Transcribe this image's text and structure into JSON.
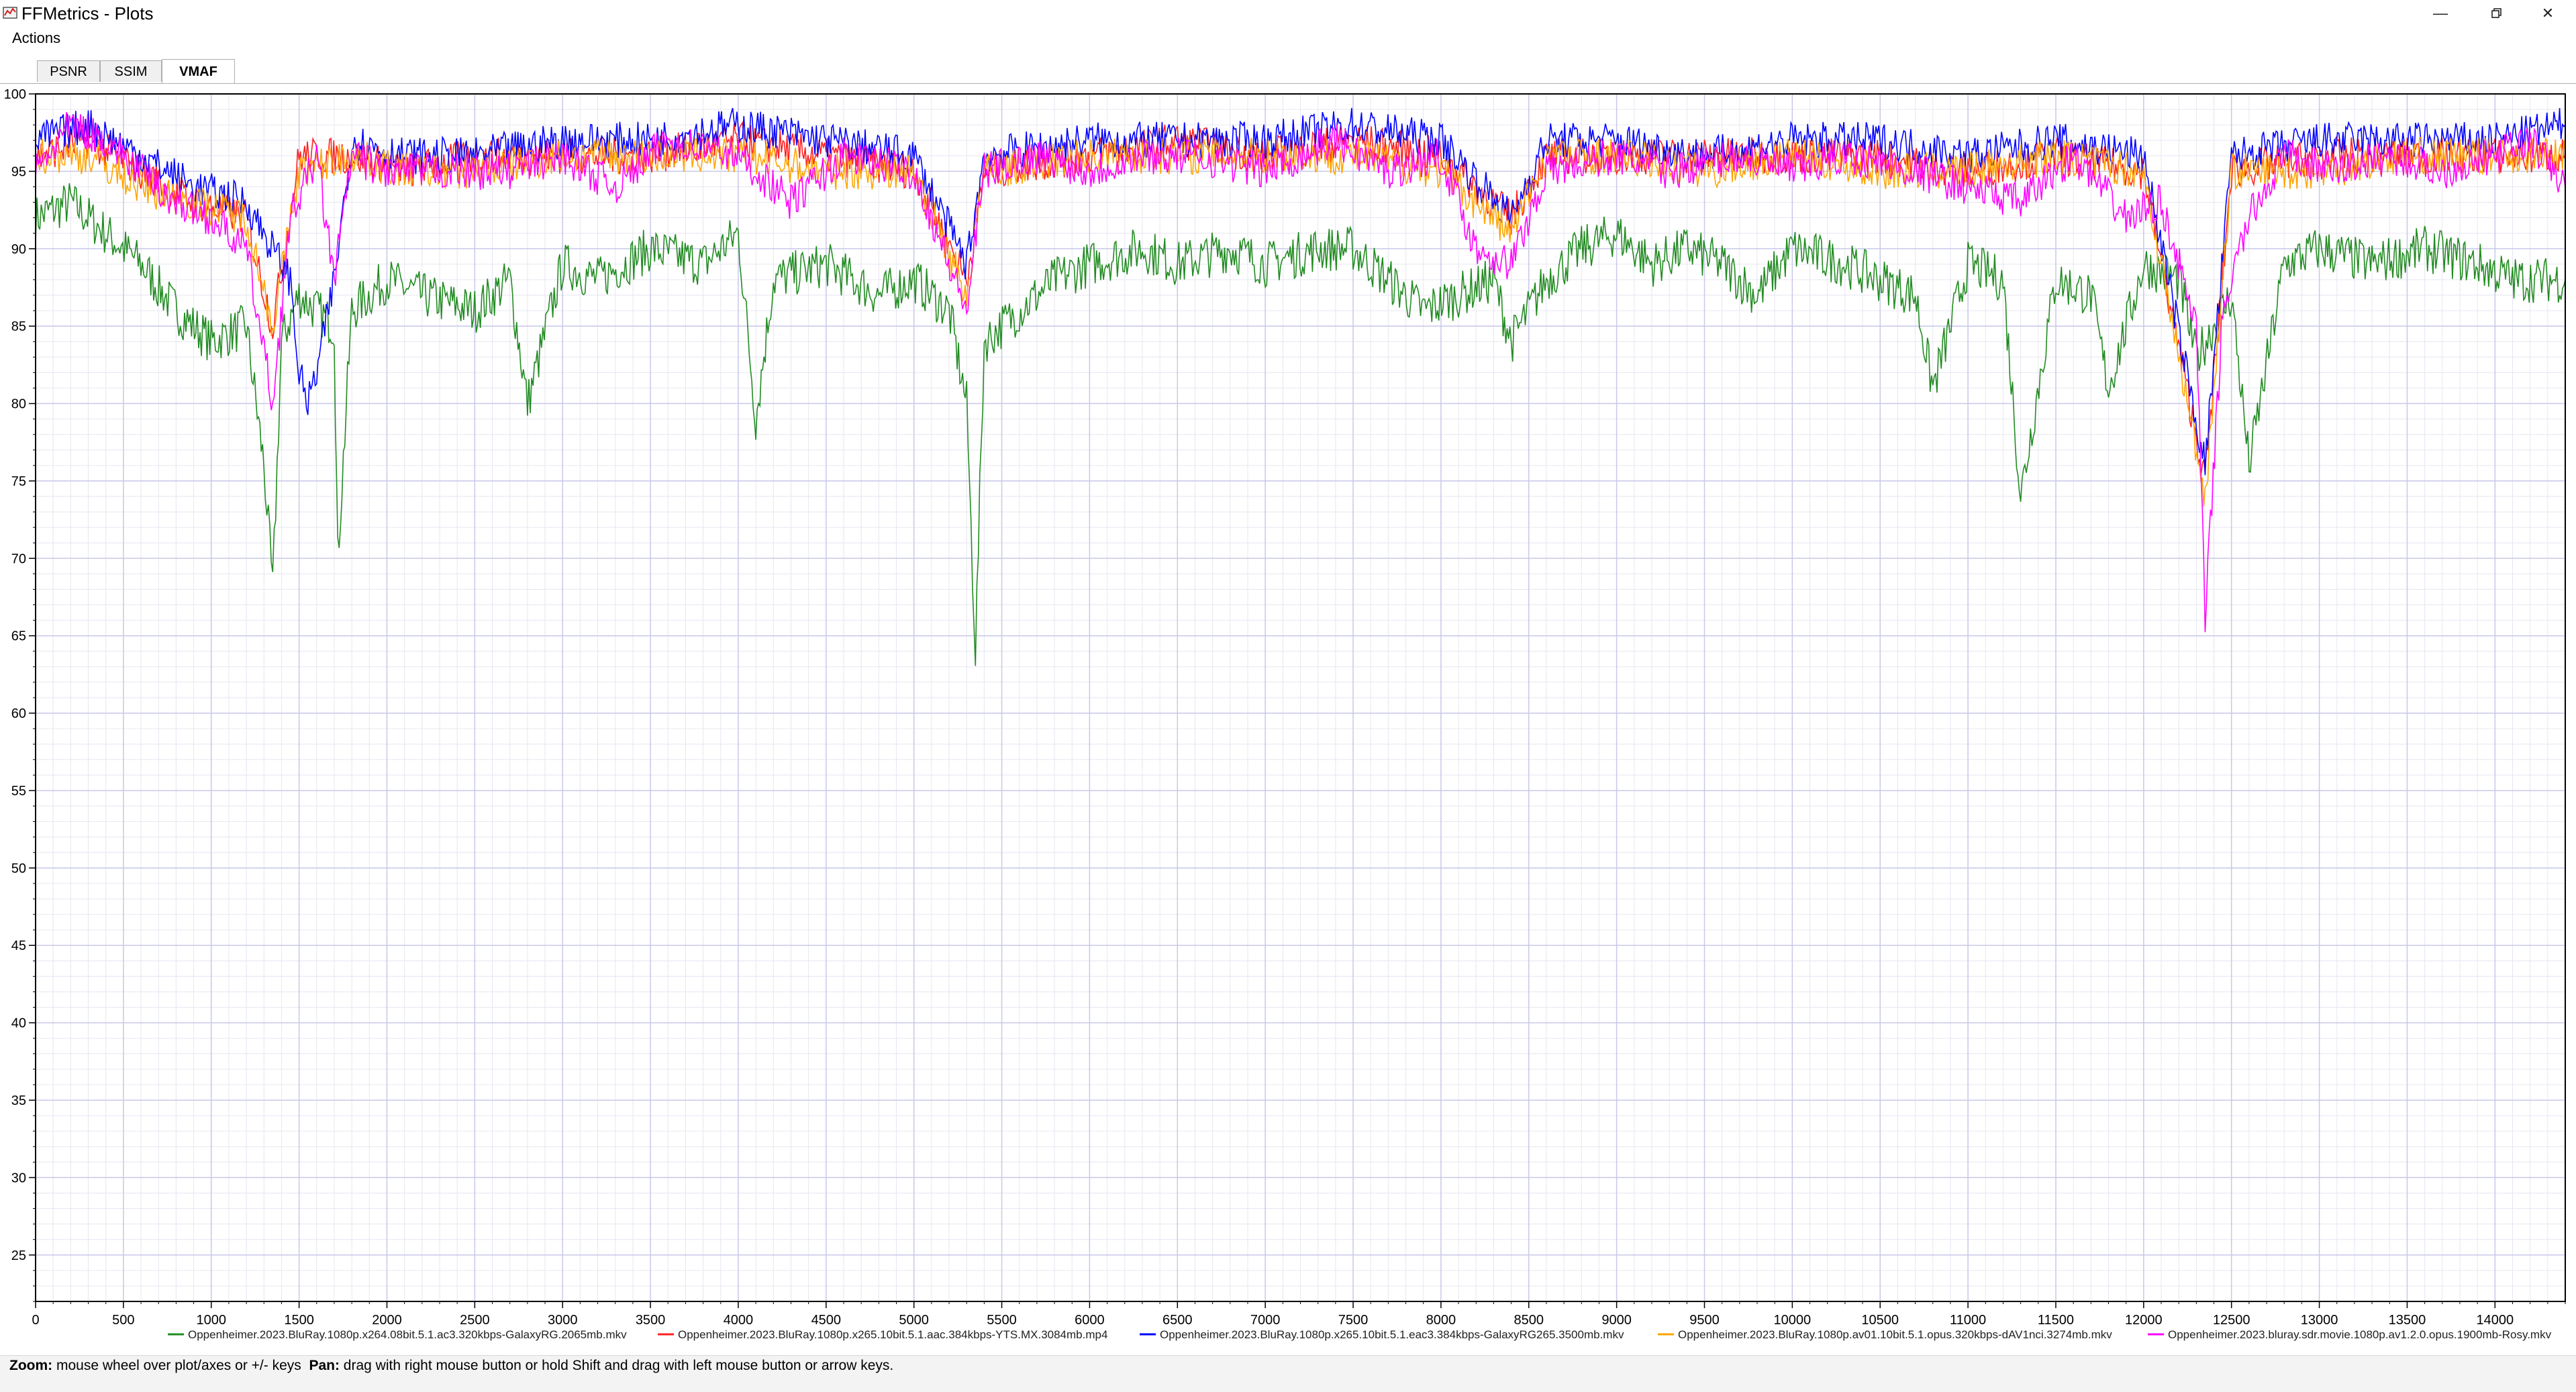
{
  "window": {
    "title": "FFMetrics - Plots"
  },
  "menu": {
    "actions_label": "Actions"
  },
  "tabs": [
    {
      "label": "PSNR",
      "active": false
    },
    {
      "label": "SSIM",
      "active": false
    },
    {
      "label": "VMAF",
      "active": true
    }
  ],
  "status": {
    "zoom_label": "Zoom:",
    "zoom_text": "mouse wheel over plot/axes or +/- keys",
    "pan_label": "Pan:",
    "pan_text": "drag with right mouse button or hold Shift and drag with left mouse button or arrow keys."
  },
  "chart_data": {
    "type": "line",
    "xlim": [
      0,
      14400
    ],
    "ylim": [
      22,
      100
    ],
    "x_ticks": [
      0,
      500,
      1000,
      1500,
      2000,
      2500,
      3000,
      3500,
      4000,
      4500,
      5000,
      5500,
      6000,
      6500,
      7000,
      7500,
      8000,
      8500,
      9000,
      9500,
      10000,
      10500,
      11000,
      11500,
      12000,
      12500,
      13000,
      13500,
      14000
    ],
    "y_ticks": [
      25,
      30,
      35,
      40,
      45,
      50,
      55,
      60,
      65,
      70,
      75,
      80,
      85,
      90,
      95,
      100
    ],
    "grid": true,
    "legend_placement": "bottom",
    "series": [
      {
        "name": "Oppenheimer.2023.BluRay.1080p.x264.08bit.5.1.ac3.320kbps-GalaxyRG.2065mb.mkv",
        "color": "#228b22",
        "points": [
          [
            0,
            92
          ],
          [
            200,
            93
          ],
          [
            400,
            91
          ],
          [
            600,
            89
          ],
          [
            800,
            86
          ],
          [
            1000,
            84
          ],
          [
            1200,
            85
          ],
          [
            1300,
            76
          ],
          [
            1350,
            68
          ],
          [
            1400,
            84
          ],
          [
            1500,
            87
          ],
          [
            1600,
            86
          ],
          [
            1700,
            85
          ],
          [
            1720,
            70
          ],
          [
            1800,
            86
          ],
          [
            2000,
            88
          ],
          [
            2200,
            87
          ],
          [
            2500,
            86
          ],
          [
            2700,
            88
          ],
          [
            2800,
            80
          ],
          [
            3000,
            89
          ],
          [
            3200,
            88
          ],
          [
            3500,
            90
          ],
          [
            3800,
            89
          ],
          [
            4000,
            91
          ],
          [
            4100,
            79
          ],
          [
            4200,
            88
          ],
          [
            4500,
            89
          ],
          [
            4800,
            87
          ],
          [
            5000,
            88
          ],
          [
            5200,
            86
          ],
          [
            5300,
            80
          ],
          [
            5350,
            64
          ],
          [
            5400,
            84
          ],
          [
            5600,
            86
          ],
          [
            5800,
            88
          ],
          [
            6000,
            89
          ],
          [
            6300,
            90
          ],
          [
            6500,
            89
          ],
          [
            6800,
            90
          ],
          [
            7000,
            89
          ],
          [
            7300,
            90
          ],
          [
            7500,
            90
          ],
          [
            7700,
            88
          ],
          [
            7900,
            86
          ],
          [
            8100,
            87
          ],
          [
            8300,
            88
          ],
          [
            8400,
            84
          ],
          [
            8600,
            88
          ],
          [
            8800,
            90
          ],
          [
            9000,
            91
          ],
          [
            9200,
            89
          ],
          [
            9400,
            90
          ],
          [
            9600,
            89
          ],
          [
            9800,
            87
          ],
          [
            10000,
            90
          ],
          [
            10300,
            89
          ],
          [
            10500,
            88
          ],
          [
            10700,
            87
          ],
          [
            10800,
            81
          ],
          [
            11000,
            89
          ],
          [
            11200,
            88
          ],
          [
            11300,
            74
          ],
          [
            11500,
            88
          ],
          [
            11700,
            87
          ],
          [
            11800,
            81
          ],
          [
            12000,
            89
          ],
          [
            12200,
            88
          ],
          [
            12300,
            83
          ],
          [
            12500,
            87
          ],
          [
            12600,
            76
          ],
          [
            12800,
            89
          ],
          [
            13000,
            90
          ],
          [
            13300,
            89
          ],
          [
            13600,
            90
          ],
          [
            13900,
            89
          ],
          [
            14100,
            88
          ],
          [
            14400,
            88
          ]
        ]
      },
      {
        "name": "Oppenheimer.2023.BluRay.1080p.x265.10bit.5.1.aac.384kbps-YTS.MX.3084mb.mp4",
        "color": "#ff2020",
        "points": [
          [
            0,
            96
          ],
          [
            300,
            97
          ],
          [
            600,
            95
          ],
          [
            900,
            93
          ],
          [
            1200,
            92
          ],
          [
            1350,
            85
          ],
          [
            1500,
            96
          ],
          [
            1800,
            96
          ],
          [
            2100,
            95
          ],
          [
            2500,
            96
          ],
          [
            3000,
            96
          ],
          [
            3500,
            96
          ],
          [
            4000,
            97
          ],
          [
            4500,
            96
          ],
          [
            5000,
            95
          ],
          [
            5300,
            88
          ],
          [
            5400,
            95
          ],
          [
            6000,
            96
          ],
          [
            6500,
            97
          ],
          [
            7000,
            96
          ],
          [
            7500,
            97
          ],
          [
            8000,
            96
          ],
          [
            8400,
            92
          ],
          [
            8600,
            96
          ],
          [
            9000,
            96
          ],
          [
            9500,
            96
          ],
          [
            10000,
            96
          ],
          [
            10500,
            96
          ],
          [
            11000,
            95
          ],
          [
            11500,
            96
          ],
          [
            12000,
            95
          ],
          [
            12350,
            75
          ],
          [
            12500,
            95
          ],
          [
            13000,
            96
          ],
          [
            13500,
            96
          ],
          [
            14000,
            96
          ],
          [
            14400,
            96
          ]
        ]
      },
      {
        "name": "Oppenheimer.2023.BluRay.1080p.x265.10bit.5.1.eac3.384kbps-GalaxyRG265.3500mb.mkv",
        "color": "#0000ff",
        "points": [
          [
            0,
            97
          ],
          [
            300,
            98
          ],
          [
            600,
            96
          ],
          [
            900,
            94
          ],
          [
            1200,
            93
          ],
          [
            1450,
            88
          ],
          [
            1500,
            82
          ],
          [
            1550,
            80
          ],
          [
            1600,
            82
          ],
          [
            1700,
            88
          ],
          [
            1800,
            97
          ],
          [
            2100,
            96
          ],
          [
            2500,
            96
          ],
          [
            3000,
            97
          ],
          [
            3500,
            97
          ],
          [
            4000,
            98
          ],
          [
            4500,
            97
          ],
          [
            5000,
            96
          ],
          [
            5300,
            89
          ],
          [
            5400,
            96
          ],
          [
            6000,
            97
          ],
          [
            6500,
            97
          ],
          [
            7000,
            97
          ],
          [
            7500,
            98
          ],
          [
            8000,
            97
          ],
          [
            8400,
            92
          ],
          [
            8600,
            97
          ],
          [
            9000,
            97
          ],
          [
            9500,
            96
          ],
          [
            10000,
            97
          ],
          [
            10500,
            97
          ],
          [
            11000,
            96
          ],
          [
            11500,
            97
          ],
          [
            12000,
            96
          ],
          [
            12350,
            76
          ],
          [
            12500,
            96
          ],
          [
            13000,
            97
          ],
          [
            13500,
            97
          ],
          [
            14000,
            97
          ],
          [
            14400,
            98
          ]
        ]
      },
      {
        "name": "Oppenheimer.2023.BluRay.1080p.av01.10bit.5.1.opus.320kbps-dAV1nci.3274mb.mkv",
        "color": "#ffa500",
        "points": [
          [
            0,
            96
          ],
          [
            300,
            96
          ],
          [
            600,
            94
          ],
          [
            900,
            93
          ],
          [
            1200,
            92
          ],
          [
            1350,
            85
          ],
          [
            1500,
            95
          ],
          [
            1800,
            96
          ],
          [
            2100,
            95
          ],
          [
            2500,
            95
          ],
          [
            3000,
            96
          ],
          [
            3500,
            96
          ],
          [
            4000,
            96
          ],
          [
            4500,
            95
          ],
          [
            5000,
            95
          ],
          [
            5300,
            87
          ],
          [
            5400,
            95
          ],
          [
            6000,
            96
          ],
          [
            6500,
            96
          ],
          [
            7000,
            96
          ],
          [
            7500,
            96
          ],
          [
            8000,
            95
          ],
          [
            8400,
            91
          ],
          [
            8600,
            96
          ],
          [
            9000,
            96
          ],
          [
            9500,
            95
          ],
          [
            10000,
            96
          ],
          [
            10500,
            95
          ],
          [
            11000,
            95
          ],
          [
            11500,
            96
          ],
          [
            12000,
            95
          ],
          [
            12350,
            74
          ],
          [
            12500,
            95
          ],
          [
            13000,
            95
          ],
          [
            13500,
            96
          ],
          [
            14000,
            96
          ],
          [
            14400,
            96
          ]
        ]
      },
      {
        "name": "Oppenheimer.2023.bluray.sdr.movie.1080p.av1.2.0.opus.1900mb-Rosy.mkv",
        "color": "#ff00ff",
        "points": [
          [
            0,
            95
          ],
          [
            200,
            98
          ],
          [
            400,
            97
          ],
          [
            600,
            95
          ],
          [
            800,
            93
          ],
          [
            1000,
            92
          ],
          [
            1200,
            90
          ],
          [
            1350,
            80
          ],
          [
            1450,
            92
          ],
          [
            1600,
            96
          ],
          [
            1700,
            88
          ],
          [
            1800,
            96
          ],
          [
            2000,
            95
          ],
          [
            2300,
            95
          ],
          [
            2700,
            95
          ],
          [
            3000,
            96
          ],
          [
            3300,
            94
          ],
          [
            3600,
            97
          ],
          [
            4000,
            96
          ],
          [
            4300,
            93
          ],
          [
            4600,
            96
          ],
          [
            5000,
            95
          ],
          [
            5300,
            86
          ],
          [
            5400,
            95
          ],
          [
            5700,
            96
          ],
          [
            6000,
            95
          ],
          [
            6300,
            96
          ],
          [
            6600,
            96
          ],
          [
            7000,
            95
          ],
          [
            7400,
            97
          ],
          [
            7700,
            95
          ],
          [
            8000,
            96
          ],
          [
            8200,
            90
          ],
          [
            8400,
            89
          ],
          [
            8600,
            95
          ],
          [
            9000,
            96
          ],
          [
            9300,
            95
          ],
          [
            9700,
            96
          ],
          [
            10000,
            95
          ],
          [
            10300,
            96
          ],
          [
            10700,
            95
          ],
          [
            11000,
            94
          ],
          [
            11300,
            93
          ],
          [
            11600,
            96
          ],
          [
            11900,
            92
          ],
          [
            12100,
            93
          ],
          [
            12300,
            85
          ],
          [
            12350,
            66
          ],
          [
            12450,
            86
          ],
          [
            12600,
            92
          ],
          [
            12800,
            96
          ],
          [
            13100,
            95
          ],
          [
            13400,
            96
          ],
          [
            13700,
            95
          ],
          [
            14000,
            96
          ],
          [
            14200,
            97
          ],
          [
            14400,
            94
          ]
        ]
      }
    ]
  }
}
